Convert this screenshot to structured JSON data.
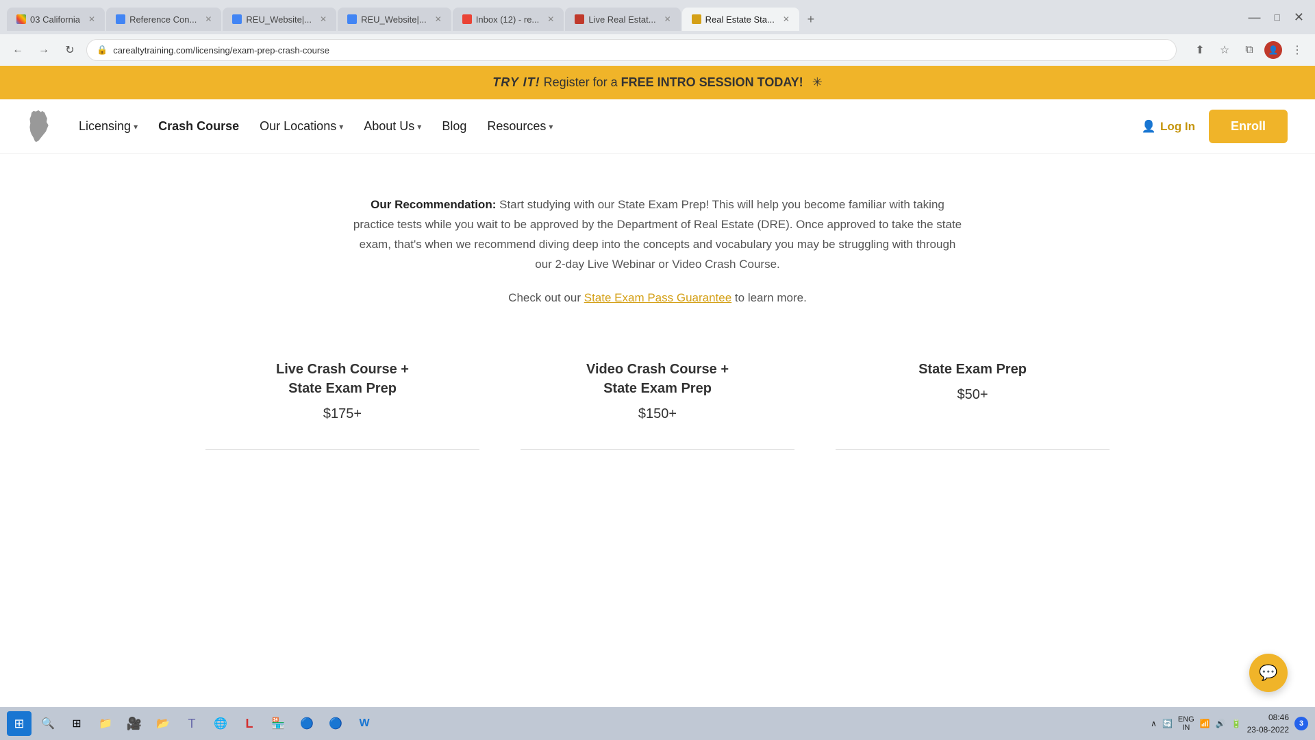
{
  "browser": {
    "tabs": [
      {
        "id": "tab1",
        "label": "03 California",
        "favicon": "google",
        "active": false
      },
      {
        "id": "tab2",
        "label": "Reference Con...",
        "favicon": "docs",
        "active": false
      },
      {
        "id": "tab3",
        "label": "REU_Website|...",
        "favicon": "docs",
        "active": false
      },
      {
        "id": "tab4",
        "label": "REU_Website|...",
        "favicon": "docs",
        "active": false
      },
      {
        "id": "tab5",
        "label": "Inbox (12) - re...",
        "favicon": "gmail",
        "active": false
      },
      {
        "id": "tab6",
        "label": "Live Real Estat...",
        "favicon": "realty",
        "active": false
      },
      {
        "id": "tab7",
        "label": "Real Estate Sta...",
        "favicon": "re-state",
        "active": true
      }
    ],
    "url": "carealtytraining.com/licensing/exam-prep-crash-course"
  },
  "banner": {
    "try_it": "TRY IT!",
    "text": " Register for a ",
    "free_text": "FREE INTRO SESSION TODAY!",
    "star": "✳"
  },
  "navbar": {
    "licensing": "Licensing",
    "crash_course": "Crash Course",
    "our_locations": "Our Locations",
    "about_us": "About Us",
    "blog": "Blog",
    "resources": "Resources",
    "login": "Log In",
    "enroll": "Enroll"
  },
  "content": {
    "recommendation_label": "Our Recommendation:",
    "recommendation_body": " Start studying with our State Exam Prep! This will help you become familiar with taking practice tests while you wait to be approved by the Department of Real Estate (DRE). Once approved to take the state exam, that's when we recommend diving deep into the concepts and vocabulary you may be struggling with through our 2-day Live Webinar or Video Crash Course.",
    "check_text": "Check out our ",
    "check_link": "State Exam Pass Guarantee",
    "check_after": " to learn more."
  },
  "pricing": [
    {
      "title": "Live Crash Course +\nState Exam Prep",
      "price": "$175+"
    },
    {
      "title": "Video Crash Course +\nState Exam Prep",
      "price": "$150+"
    },
    {
      "title": "State Exam Prep",
      "price": "$50+"
    }
  ],
  "taskbar": {
    "time": "08:46",
    "date": "23-08-2022",
    "lang": "ENG\nIN",
    "notification_count": "3"
  }
}
